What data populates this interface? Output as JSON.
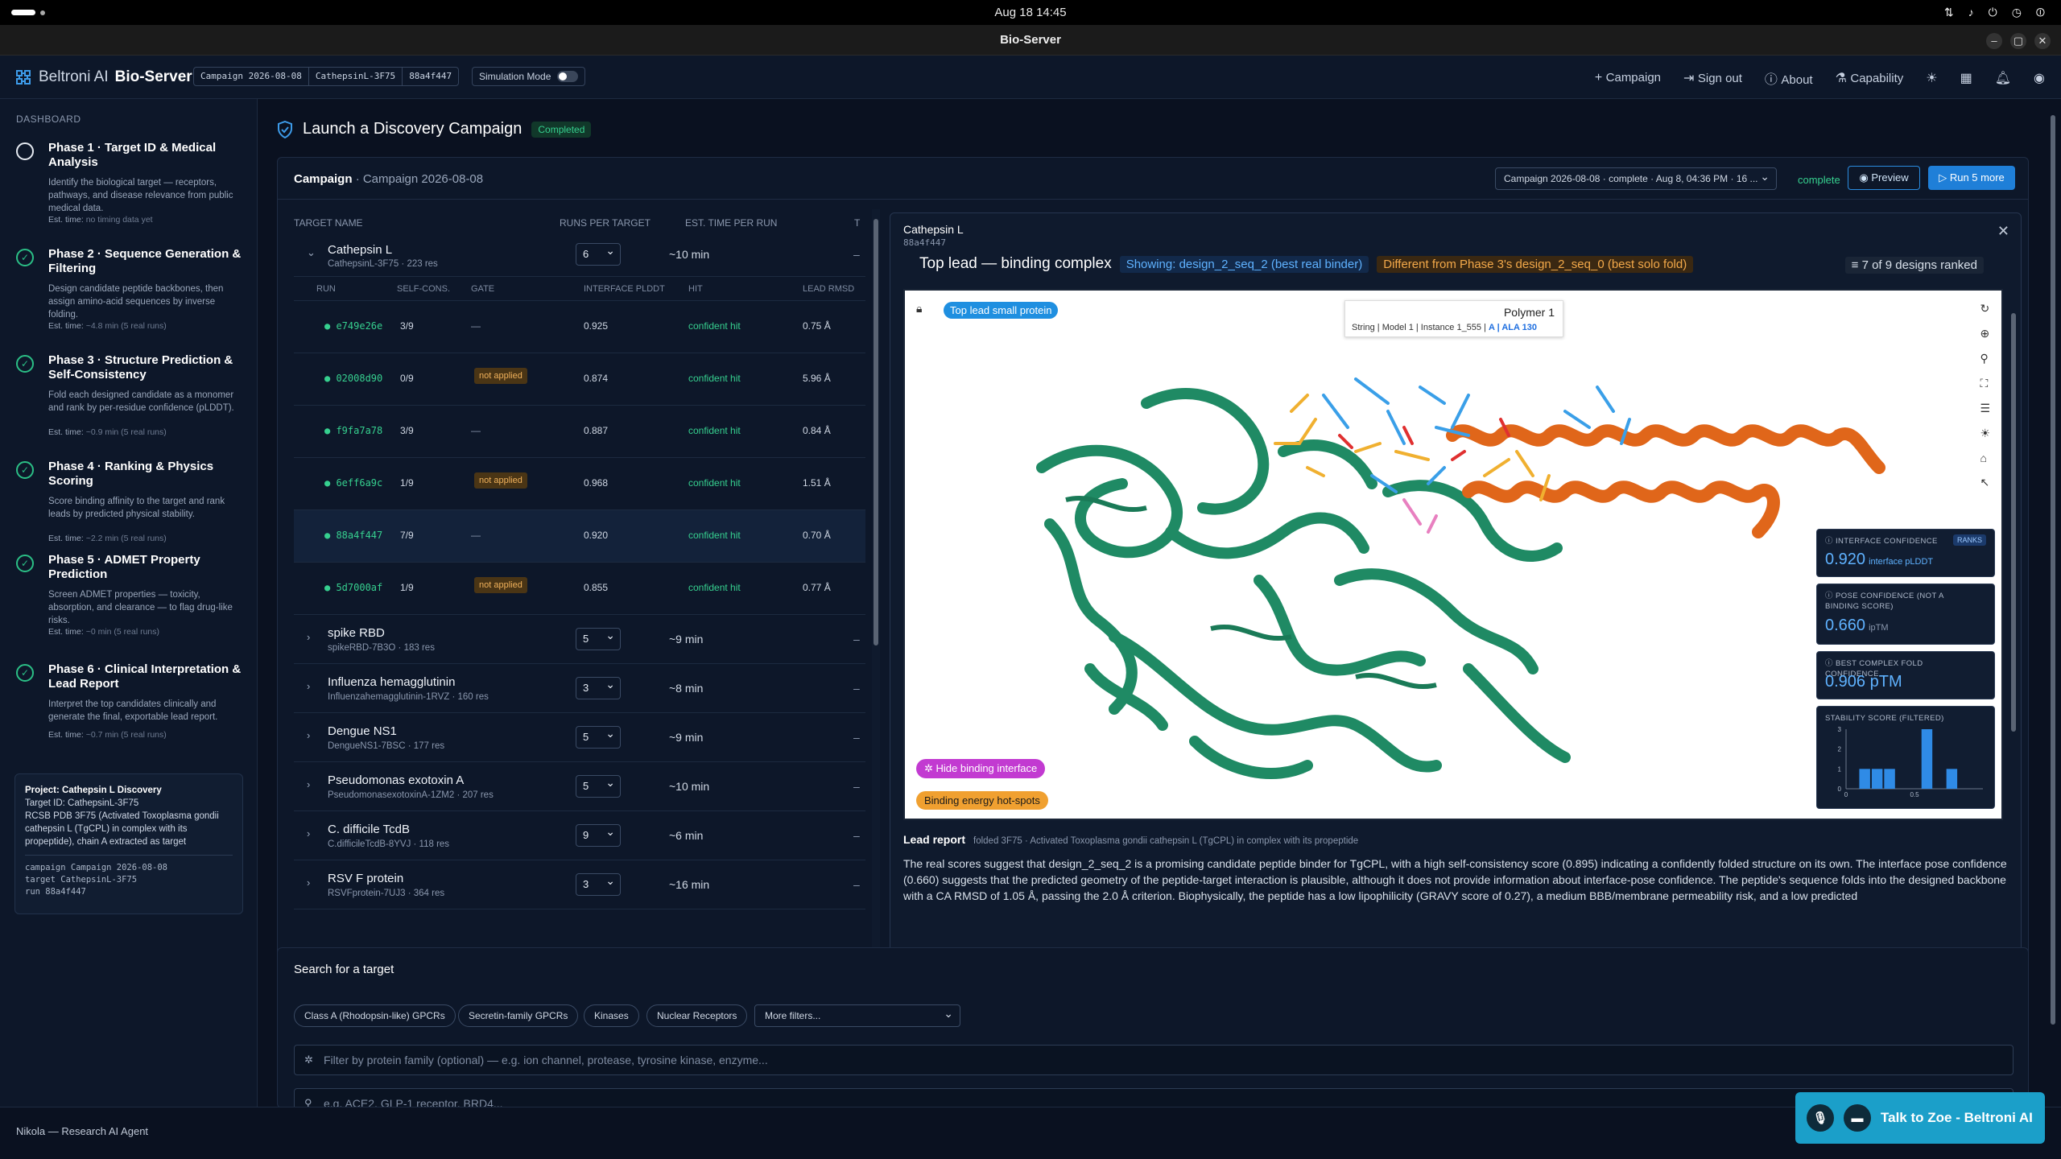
{
  "os": {
    "clock": "Aug 18  14:45"
  },
  "window": {
    "title": "Bio-Server"
  },
  "app": {
    "brand_prefix": "Beltroni AI",
    "brand_name": "Bio-Server",
    "chips": [
      "Campaign 2026-08-08",
      "CathepsinL-3F75",
      "88a4f447"
    ],
    "sim_mode_label": "Simulation Mode",
    "nav": {
      "campaign": "Campaign",
      "signout": "Sign out",
      "about": "About",
      "capability": "Capability"
    }
  },
  "sidebar": {
    "header": "DASHBOARD",
    "phases": [
      {
        "title": "Phase 1 · Target ID & Medical Analysis",
        "desc": "Identify the biological target — receptors, pathways, and disease relevance from public medical data.",
        "est_label": "Est. time:",
        "est": "no timing data yet",
        "state": "open"
      },
      {
        "title": "Phase 2 · Sequence Generation & Filtering",
        "desc": "Design candidate peptide backbones, then assign amino-acid sequences by inverse folding.",
        "est_label": "Est. time:",
        "est": "~4.8 min (5 real runs)",
        "state": "done"
      },
      {
        "title": "Phase 3 · Structure Prediction & Self-Consistency",
        "desc": "Fold each designed candidate as a monomer and rank by per-residue confidence (pLDDT).",
        "est_label": "Est. time:",
        "est": "~0.9 min (5 real runs)",
        "state": "done"
      },
      {
        "title": "Phase 4 · Ranking & Physics Scoring",
        "desc": "Score binding affinity to the target and rank leads by predicted physical stability.",
        "est_label": "Est. time:",
        "est": "~2.2 min (5 real runs)",
        "state": "done"
      },
      {
        "title": "Phase 5 · ADMET Property Prediction",
        "desc": "Screen ADMET properties — toxicity, absorption, and clearance — to flag drug-like risks.",
        "est_label": "Est. time:",
        "est": "~0 min (5 real runs)",
        "state": "done"
      },
      {
        "title": "Phase 6 · Clinical Interpretation & Lead Report",
        "desc": "Interpret the top candidates clinically and generate the final, exportable lead report.",
        "est_label": "Est. time:",
        "est": "~0.7 min (5 real runs)",
        "state": "done"
      }
    ],
    "project": {
      "title": "Project: Cathepsin L Discovery",
      "target_id": "Target ID: CathepsinL-3F75",
      "desc": "RCSB PDB 3F75 (Activated Toxoplasma gondii cathepsin L (TgCPL) in complex with its propeptide), chain A extracted as target",
      "code": "campaign Campaign 2026-08-08\ntarget CathepsinL-3F75\nrun 88a4f447"
    }
  },
  "page": {
    "title": "Launch a Discovery Campaign",
    "status": "Completed"
  },
  "campaign": {
    "label": "Campaign",
    "name": "· Campaign 2026-08-08",
    "select_value": "Campaign 2026-08-08 · complete · Aug 8, 04:36 PM · 16 ...",
    "status": "complete",
    "preview": "Preview",
    "run_more": "Run 5 more",
    "headers": {
      "target": "TARGET NAME",
      "runs": "RUNS PER TARGET",
      "est": "EST. TIME PER RUN",
      "t": "T"
    },
    "sub_headers": {
      "run": "RUN",
      "selfcons": "SELF-CONS.",
      "gate": "GATE",
      "iplddt": "INTERFACE PLDDT",
      "hit": "HIT",
      "rmsd": "LEAD RMSD"
    },
    "expanded": {
      "name": "Cathepsin L",
      "sub": "CathepsinL-3F75 · 223 res",
      "runs": "6",
      "est": "~10 min",
      "dash": "–"
    },
    "runs": [
      {
        "id": "e749e26e",
        "sc": "3/9",
        "gate": "—",
        "gate_na": false,
        "pl": "0.925",
        "hit": "confident hit",
        "rm": "0.75 Å"
      },
      {
        "id": "02008d90",
        "sc": "0/9",
        "gate": "not applied",
        "gate_na": true,
        "pl": "0.874",
        "hit": "confident hit",
        "rm": "5.96 Å"
      },
      {
        "id": "f9fa7a78",
        "sc": "3/9",
        "gate": "—",
        "gate_na": false,
        "pl": "0.887",
        "hit": "confident hit",
        "rm": "0.84 Å"
      },
      {
        "id": "6eff6a9c",
        "sc": "1/9",
        "gate": "not applied",
        "gate_na": true,
        "pl": "0.968",
        "hit": "confident hit",
        "rm": "1.51 Å"
      },
      {
        "id": "88a4f447",
        "sc": "7/9",
        "gate": "—",
        "gate_na": false,
        "pl": "0.920",
        "hit": "confident hit",
        "rm": "0.70 Å"
      },
      {
        "id": "5d7000af",
        "sc": "1/9",
        "gate": "not applied",
        "gate_na": true,
        "pl": "0.855",
        "hit": "confident hit",
        "rm": "0.77 Å"
      }
    ],
    "targets": [
      {
        "name": "spike RBD",
        "sub": "spikeRBD-7B3O · 183 res",
        "runs": "5",
        "est": "~9 min",
        "dash": "–"
      },
      {
        "name": "Influenza hemagglutinin",
        "sub": "Influenzahemagglutinin-1RVZ · 160 res",
        "runs": "3",
        "est": "~8 min",
        "dash": "–"
      },
      {
        "name": "Dengue NS1",
        "sub": "DengueNS1-7BSC · 177 res",
        "runs": "5",
        "est": "~9 min",
        "dash": "–"
      },
      {
        "name": "Pseudomonas exotoxin A",
        "sub": "PseudomonasexotoxinA-1ZM2 · 207 res",
        "runs": "5",
        "est": "~10 min",
        "dash": "–"
      },
      {
        "name": "C. difficile TcdB",
        "sub": "C.difficileTcdB-8YVJ · 118 res",
        "runs": "9",
        "est": "~6 min",
        "dash": "–"
      },
      {
        "name": "RSV F protein",
        "sub": "RSVFprotein-7UJ3 · 364 res",
        "runs": "3",
        "est": "~16 min",
        "dash": "–"
      }
    ]
  },
  "detail": {
    "title": "Cathepsin L",
    "run": "88a4f447",
    "lead_title": "Top lead — binding complex",
    "showing": "Showing: design_2_seq_2 (best real binder)",
    "different": "Different from Phase 3's design_2_seq_0 (best solo fold)",
    "rank": "7 of 9 designs ranked",
    "viewer_badge": "Top lead small protein",
    "poly_title": "Polymer 1",
    "poly_info": "String | Model 1 | Instance 1_555 | ",
    "poly_res": "A | ALA 130",
    "hide_binding": "Hide binding interface",
    "binding_hot": "Binding energy hot-spots",
    "metrics": {
      "iface_label": "INTERFACE CONFIDENCE",
      "iface_rank": "RANKS",
      "iface_val": "0.920",
      "iface_unit": "interface pLDDT",
      "pose_label": "POSE CONFIDENCE (NOT A BINDING SCORE)",
      "pose_val": "0.660",
      "pose_unit": "ipTM",
      "fold_label": "BEST COMPLEX FOLD CONFIDENCE",
      "fold_val": "0.906 pTM",
      "stab_label": "STABILITY SCORE (FILTERED)"
    },
    "lead_report_label": "Lead report",
    "lead_report_meta": "folded 3F75 · Activated Toxoplasma gondii cathepsin L (TgCPL) in complex with its propeptide",
    "lead_report_text": "The real scores suggest that design_2_seq_2 is a promising candidate peptide binder for TgCPL, with a high self-consistency score (0.895) indicating a confidently folded structure on its own. The interface pose confidence (0.660) suggests that the predicted geometry of the peptide-target interaction is plausible, although it does not provide information about interface-pose confidence. The peptide's sequence folds into the designed backbone with a CA RMSD of 1.05 Å, passing the 2.0 Å criterion. Biophysically, the peptide has a low lipophilicity (GRAVY score of 0.27), a medium BBB/membrane permeability risk, and a low predicted"
  },
  "chart_data": {
    "type": "bar",
    "title": "STABILITY SCORE (FILTERED)",
    "categories": [
      "0",
      "0.1",
      "0.2",
      "0.3",
      "0.4",
      "0.5",
      "0.6",
      "0.7",
      "0.8",
      "0.9",
      "1"
    ],
    "values": [
      0,
      1,
      1,
      1,
      0,
      0,
      3,
      0,
      1,
      0,
      0
    ],
    "ylim": [
      0,
      3
    ],
    "yticks": [
      "0",
      "1",
      "2",
      "3"
    ],
    "xticks": [
      "0",
      "0.5"
    ]
  },
  "search": {
    "title": "Search for a target",
    "chips": [
      "Class A (Rhodopsin-like) GPCRs",
      "Secretin-family GPCRs",
      "Kinases",
      "Nuclear Receptors"
    ],
    "more": "More filters...",
    "family_placeholder": "Filter by protein family (optional) — e.g. ion channel, protease, tyrosine kinase, enzyme...",
    "query_placeholder": "e.g. ACE2, GLP-1 receptor, BRD4..."
  },
  "footer": {
    "user": "Nikola — Research AI Agent",
    "talk": "Talk to Zoe - Beltroni AI"
  },
  "colors": {
    "accent": "#1f7fd8",
    "success": "#36d08f",
    "warn": "#f0b15b",
    "protein": "#1f8a64",
    "helix": "#e0661a"
  }
}
